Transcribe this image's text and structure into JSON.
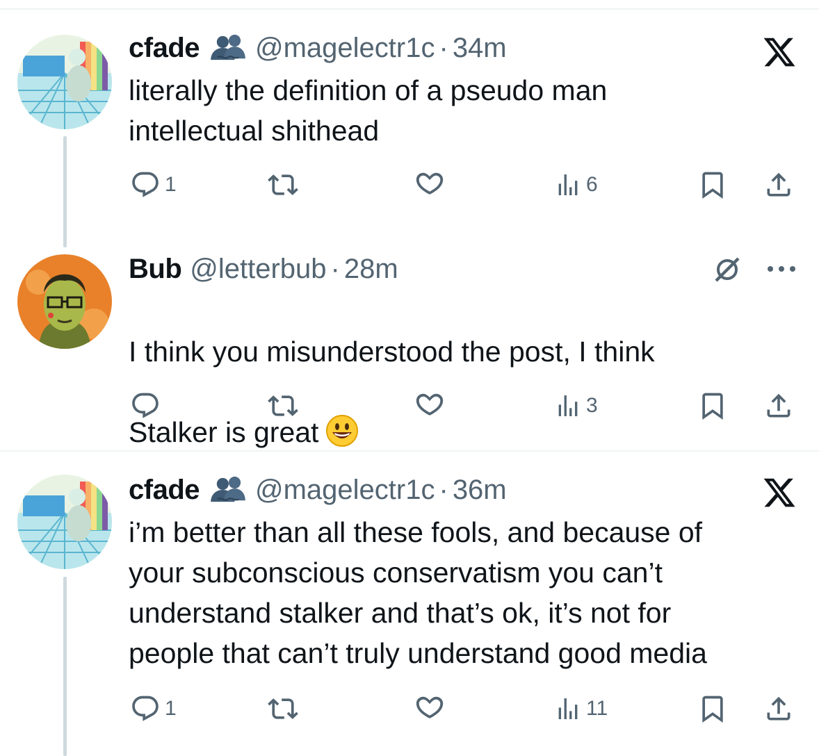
{
  "tweets": [
    {
      "name": "cfade",
      "handle": "@magelectr1c",
      "time": "34m",
      "text": "literally the definition of a pseudo man\nintellectual shithead",
      "replies": "1",
      "views": "6"
    },
    {
      "name": "Bub",
      "handle": "@letterbub",
      "time": "28m",
      "text_line1": "I think you misunderstood the post, I think",
      "text_line2": "Stalker is great",
      "replies": "",
      "views": "3"
    },
    {
      "name": "cfade",
      "handle": "@magelectr1c",
      "time": "36m",
      "text": "i’m better than all these fools, and  because of\nyour subconscious conservatism you can’t\nunderstand stalker and that’s ok, it’s not for\npeople that can’t truly understand good media",
      "replies": "1",
      "views": "11"
    }
  ],
  "separator": "·",
  "icons": {
    "reply": "reply-icon",
    "retweet": "retweet-icon",
    "like": "like-icon",
    "views": "views-icon",
    "bookmark": "bookmark-icon",
    "share": "share-icon",
    "x_logo": "x-logo-icon",
    "grok": "grok-icon",
    "more": "more-icon",
    "affiliate": "affiliate-badge-icon",
    "emoji": "smiley-emoji"
  },
  "colors": {
    "text": "#0f1419",
    "secondary": "#536471",
    "divider": "#eff3f4",
    "thread": "#cfd9de"
  }
}
